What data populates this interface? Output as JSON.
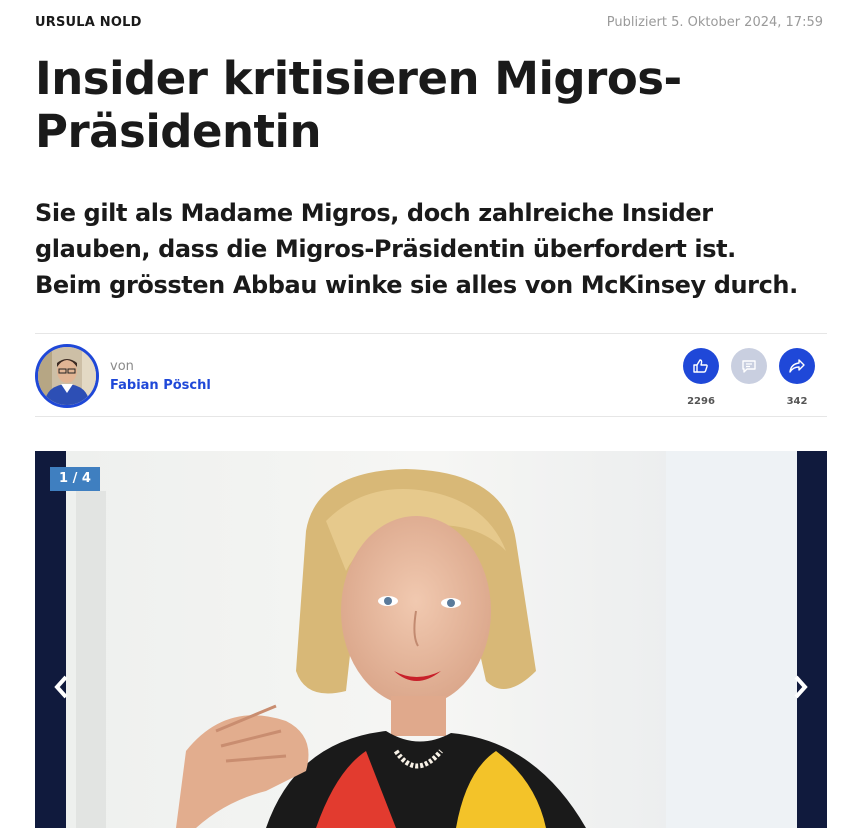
{
  "article": {
    "kicker": "URSULA NOLD",
    "published": "Publiziert 5. Oktober 2024, 17:59",
    "headline": "Insider kritisieren Migros-Präsidentin",
    "lead": "Sie gilt als Madame Migros, doch zahlreiche Insider glauben, dass die Migros-Präsidentin überfordert ist. Beim grössten Abbau winke sie alles von McKinsey durch."
  },
  "author": {
    "by_label": "von",
    "name": "Fabian Pöschl"
  },
  "actions": {
    "reactions": {
      "icon": "reaction-icon",
      "count": "2296"
    },
    "comments": {
      "icon": "comment-icon",
      "count": ""
    },
    "share": {
      "icon": "share-icon",
      "count": "342"
    }
  },
  "gallery": {
    "counter": "1 / 4",
    "prev_icon": "chevron-left-icon",
    "next_icon": "chevron-right-icon"
  },
  "colors": {
    "accent": "#1f48d8",
    "counter_bg": "#3f7fc0",
    "gallery_bg": "#101a3d",
    "muted_button": "#c9cfe0"
  }
}
